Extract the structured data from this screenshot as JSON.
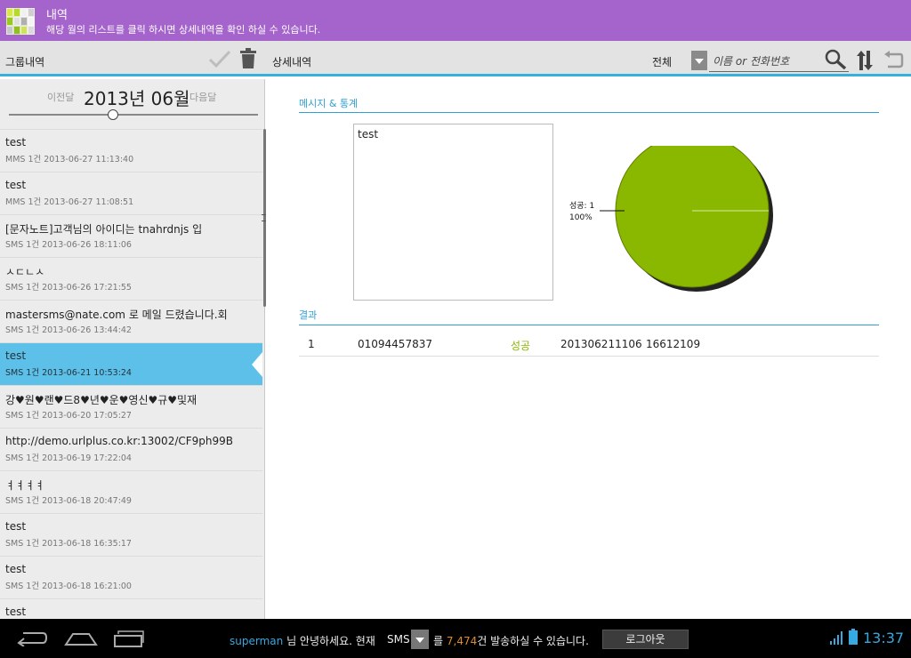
{
  "header": {
    "title": "내역",
    "subtitle": "해당 월의 리스트를 클릭 하시면 상세내역을 확인 하실 수 있습니다."
  },
  "toolbar": {
    "group_label": "그룹내역",
    "detail_label": "상세내역",
    "filter_value": "전체",
    "search_placeholder": "이름 or 전화번호"
  },
  "month_nav": {
    "prev": "이전달",
    "current": "2013년 06월",
    "next": "다음달"
  },
  "messages": [
    {
      "subject": "test",
      "meta": "MMS 1건 2013-06-27 11:13:40"
    },
    {
      "subject": "test",
      "meta": "MMS 1건 2013-06-27 11:08:51"
    },
    {
      "subject": "[문자노트]고객님의 아이디는 tnahrdnjs 입",
      "meta": "SMS 1건 2013-06-26 18:11:06"
    },
    {
      "subject": "ㅅㄷㄴㅅ",
      "meta": "SMS 1건 2013-06-26 17:21:55"
    },
    {
      "subject": "mastersms@nate.com 로 메일 드렸습니다.회",
      "meta": "SMS 1건 2013-06-26 13:44:42"
    },
    {
      "subject": "test",
      "meta": "SMS 1건 2013-06-21 10:53:24"
    },
    {
      "subject": "강♥원♥랜♥드8♥년♥운♥영신♥규♥및재",
      "meta": "SMS 1건 2013-06-20 17:05:27"
    },
    {
      "subject": "http://demo.urlplus.co.kr:13002/CF9ph99B",
      "meta": "SMS 1건 2013-06-19 17:22:04"
    },
    {
      "subject": "ㅕㅕㅕㅕ",
      "meta": "SMS 1건 2013-06-18 20:47:49"
    },
    {
      "subject": "test",
      "meta": "SMS 1건 2013-06-18 16:35:17"
    },
    {
      "subject": "test",
      "meta": "SMS 1건 2013-06-18 16:21:00"
    },
    {
      "subject": "test",
      "meta": ""
    }
  ],
  "selected_index": 5,
  "detail": {
    "section_stats": "메시지 & 통계",
    "message_body": "test",
    "section_result": "결과",
    "result": {
      "index": "1",
      "phone": "01094457837",
      "status": "성공",
      "datetime": "201306211106",
      "code": "16612109"
    }
  },
  "chart_data": {
    "type": "pie",
    "categories": [
      "성공"
    ],
    "values": [
      1
    ],
    "labels": [
      "성공: 1",
      "100%"
    ],
    "colors": [
      "#8ab800"
    ]
  },
  "footer": {
    "username": "superman",
    "greeting": "님 안녕하세요. 현재",
    "sms_type": "SMS",
    "msg_pre": "를",
    "count": "7,474",
    "msg_post": "건 발송하실 수 있습니다.",
    "logout": "로그아웃",
    "time": "13:37"
  },
  "colors": {
    "header_bg": "#a464cc",
    "accent": "#38b0dc",
    "selected_row": "#5cc0e8",
    "success": "#8ab800"
  }
}
